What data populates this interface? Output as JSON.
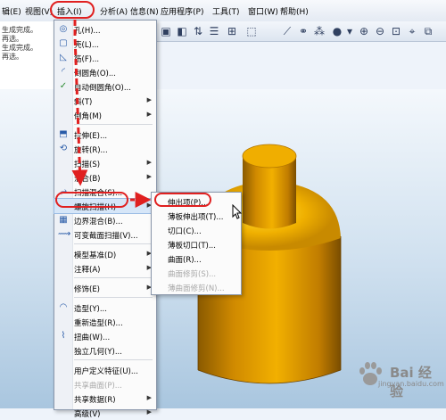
{
  "menubar": {
    "items": [
      "辑(E)",
      "视图(V)",
      "插入(I)",
      "分析(A)",
      "信息(N)",
      "应用程序(P)",
      "工具(T)",
      "窗口(W)",
      "帮助(H)"
    ]
  },
  "messages": [
    "生成完成。",
    "再选。",
    "生成完成。",
    "再选。"
  ],
  "insert_menu": {
    "items": [
      {
        "label": "孔(H)...",
        "icon": "hole-icon",
        "arrow": false
      },
      {
        "label": "壳(L)...",
        "icon": "shell-icon",
        "arrow": false
      },
      {
        "label": "筋(F)...",
        "icon": "rib-icon",
        "arrow": false
      },
      {
        "label": "倒圆角(O)...",
        "icon": "round-icon",
        "arrow": false
      },
      {
        "label": "自动倒圆角(O)...",
        "icon": "auto-round-icon",
        "arrow": false
      },
      {
        "label": "斜(T)",
        "icon": "",
        "arrow": true
      },
      {
        "label": "倒角(M)",
        "icon": "",
        "arrow": true
      },
      {
        "label": "拉伸(E)...",
        "icon": "extrude-icon",
        "arrow": false
      },
      {
        "label": "旋转(R)...",
        "icon": "revolve-icon",
        "arrow": false
      },
      {
        "label": "扫描(S)",
        "icon": "",
        "arrow": true
      },
      {
        "label": "混合(B)",
        "icon": "",
        "arrow": true
      },
      {
        "label": "扫描混合(S)...",
        "icon": "swept-blend-icon",
        "arrow": false
      },
      {
        "label": "螺旋扫描(H)",
        "icon": "",
        "arrow": true
      },
      {
        "label": "边界混合(B)...",
        "icon": "boundary-blend-icon",
        "arrow": false
      },
      {
        "label": "可变截面扫描(V)...",
        "icon": "var-sweep-icon",
        "arrow": false
      },
      {
        "label": "模型基准(D)",
        "icon": "",
        "arrow": true
      },
      {
        "label": "注释(A)",
        "icon": "",
        "arrow": true
      },
      {
        "label": "修饰(E)",
        "icon": "",
        "arrow": true
      },
      {
        "label": "造型(Y)...",
        "icon": "style-icon",
        "arrow": false
      },
      {
        "label": "重新造型(R)...",
        "icon": "",
        "arrow": false
      },
      {
        "label": "扭曲(W)...",
        "icon": "warp-icon",
        "arrow": false
      },
      {
        "label": "独立几何(Y)...",
        "icon": "",
        "arrow": false
      },
      {
        "label": "用户定义特征(U)...",
        "icon": "",
        "arrow": false
      },
      {
        "label": "共享数据(R)",
        "icon": "",
        "arrow": true
      },
      {
        "label": "高级(V)",
        "icon": "",
        "arrow": true
      }
    ],
    "disabled_label": "共享曲面(P)..."
  },
  "helix_submenu": {
    "items": [
      {
        "label": "伸出项(P)...",
        "disabled": false
      },
      {
        "label": "薄板伸出项(T)...",
        "disabled": false
      },
      {
        "label": "切口(C)...",
        "disabled": false
      },
      {
        "label": "薄板切口(T)...",
        "disabled": false
      },
      {
        "label": "曲面(R)...",
        "disabled": false
      },
      {
        "label": "曲面修剪(S)...",
        "disabled": true
      },
      {
        "label": "薄曲面修剪(N)...",
        "disabled": true
      }
    ]
  },
  "watermark": {
    "text": "Bai 经验",
    "url": "jingyan.baidu.com"
  },
  "colors": {
    "highlight": "#e02020",
    "model": "#d89000"
  }
}
